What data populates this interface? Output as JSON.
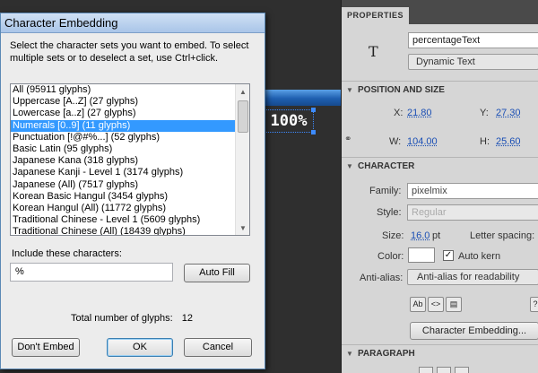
{
  "dialog": {
    "title": "Character Embedding",
    "instructions": "Select the character sets you want to embed. To select multiple sets or to deselect a set, use Ctrl+click.",
    "glyph_sets": [
      {
        "label": "All  (95911 glyphs)",
        "selected": false
      },
      {
        "label": "Uppercase [A..Z]  (27 glyphs)",
        "selected": false
      },
      {
        "label": "Lowercase [a..z]  (27 glyphs)",
        "selected": false
      },
      {
        "label": "Numerals [0..9]  (11 glyphs)",
        "selected": true
      },
      {
        "label": "Punctuation [!@#%...]  (52 glyphs)",
        "selected": false
      },
      {
        "label": "Basic Latin  (95 glyphs)",
        "selected": false
      },
      {
        "label": "Japanese Kana  (318 glyphs)",
        "selected": false
      },
      {
        "label": "Japanese Kanji - Level 1 (3174 glyphs)",
        "selected": false
      },
      {
        "label": "Japanese (All)  (7517 glyphs)",
        "selected": false
      },
      {
        "label": "Korean Basic Hangul (3454 glyphs)",
        "selected": false
      },
      {
        "label": "Korean Hangul (All) (11772 glyphs)",
        "selected": false
      },
      {
        "label": "Traditional Chinese - Level 1 (5609 glyphs)",
        "selected": false
      },
      {
        "label": "Traditional Chinese (All)  (18439 glyphs)",
        "selected": false
      }
    ],
    "include_label": "Include these characters:",
    "include_value": "%",
    "autofill_label": "Auto Fill",
    "total_label": "Total number of glyphs:",
    "total_value": "12",
    "dont_embed_label": "Don't Embed",
    "ok_label": "OK",
    "cancel_label": "Cancel"
  },
  "stage": {
    "text": "100%"
  },
  "properties": {
    "tab_label": "PROPERTIES",
    "instance_name": "percentageText",
    "text_type": "Dynamic Text",
    "position_section": "POSITION AND SIZE",
    "x_label": "X:",
    "x_value": "21.80",
    "y_label": "Y:",
    "y_value": "27.30",
    "w_label": "W:",
    "w_value": "104.00",
    "h_label": "H:",
    "h_value": "25.60",
    "character_section": "CHARACTER",
    "family_label": "Family:",
    "family_value": "pixelmix",
    "style_label": "Style:",
    "style_value": "Regular",
    "size_label": "Size:",
    "size_value": "16.0",
    "size_unit": "pt",
    "letter_spacing_label": "Letter spacing:",
    "color_label": "Color:",
    "autokern_label": "Auto kern",
    "antialias_label": "Anti-alias:",
    "antialias_value": "Anti-alias for readability",
    "char_embed_button": "Character Embedding...",
    "paragraph_section": "PARAGRAPH"
  }
}
